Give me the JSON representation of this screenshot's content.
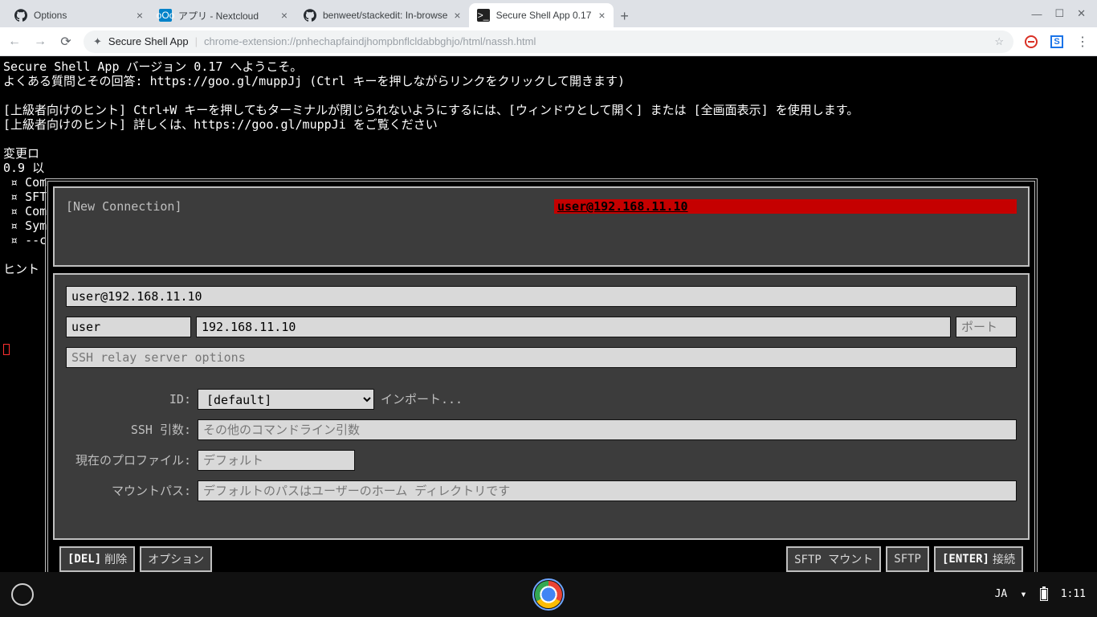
{
  "browser": {
    "tabs": [
      {
        "title": "Options",
        "favicon": "github"
      },
      {
        "title": "アプリ - Nextcloud",
        "favicon": "nextcloud"
      },
      {
        "title": "benweet/stackedit: In-browse",
        "favicon": "github"
      },
      {
        "title": "Secure Shell App 0.17",
        "favicon": "terminal",
        "active": true
      }
    ],
    "omnibox": {
      "app_name": "Secure Shell App",
      "url": "chrome-extension://pnhechapfaindjhompbnflcldabbghjo/html/nassh.html"
    }
  },
  "terminal": {
    "lines_block": "Secure Shell App バージョン 0.17 へようこそ。\nよくある質問とその回答: https://goo.gl/muppJj (Ctrl キーを押しながらリンクをクリックして開きます)\n\n[上級者向けのヒント] Ctrl+W キーを押してもターミナルが閉じられないようにするには、[ウィンドウとして開く] または [全画面表示] を使用します。\n[上級者向けのヒント] 詳しくは、https://goo.gl/muppJi をご覧ください\n\n変更ロ\n0.9 以\n ¤ Com\n ¤ SFT\n ¤ Com\n ¤ Sym\n ¤ --c\n\nヒント"
  },
  "dialog": {
    "new_connection_label": "[New Connection]",
    "connection_highlight": "user@192.168.11.10",
    "connection_string": "user@192.168.11.10",
    "username": "user",
    "host": "192.168.11.10",
    "port_placeholder": "ポート",
    "relay_placeholder": "SSH relay server options",
    "id_label": "ID:",
    "id_value": "[default]",
    "import_label": "インポート...",
    "ssh_args_label": "SSH 引数:",
    "ssh_args_placeholder": "その他のコマンドライン引数",
    "profile_label": "現在のプロファイル:",
    "profile_placeholder": "デフォルト",
    "mount_label": "マウントパス:",
    "mount_placeholder": "デフォルトのパスはユーザーのホーム ディレクトリです",
    "buttons": {
      "del_key": "[DEL]",
      "del_label": "削除",
      "options": "オプション",
      "sftp_mount": "SFTP マウント",
      "sftp": "SFTP",
      "enter_key": "[ENTER]",
      "enter_label": "接続"
    }
  },
  "shelf": {
    "ime": "JA",
    "time": "1:11"
  }
}
